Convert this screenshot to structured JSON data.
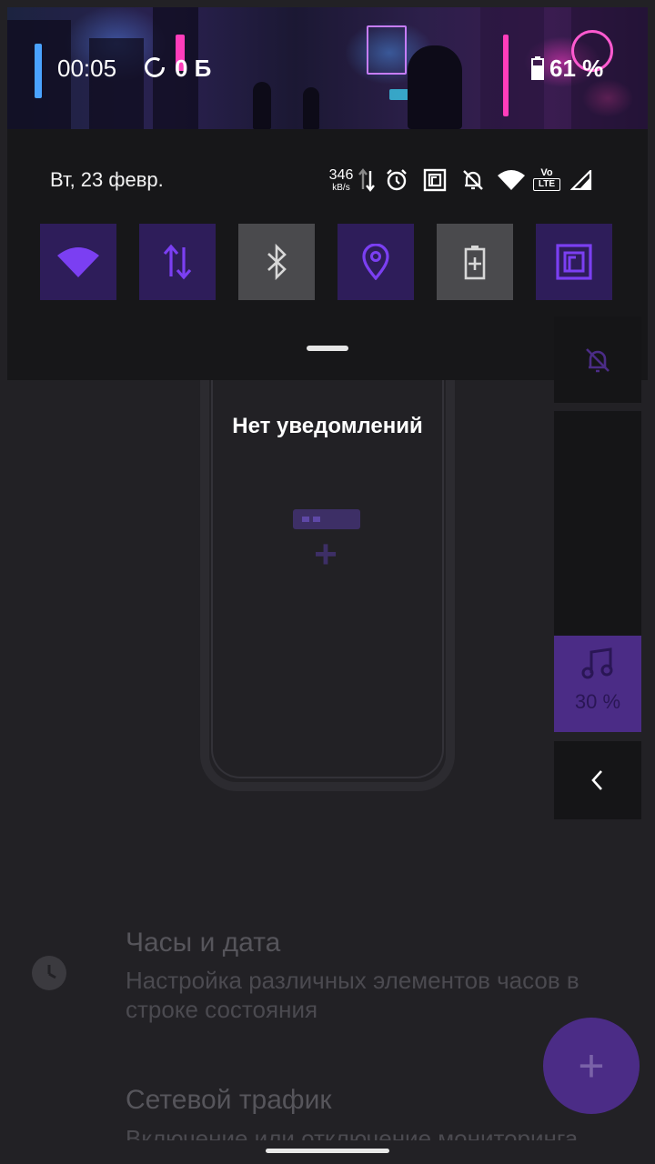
{
  "status_bar": {
    "time": "00:05",
    "data_usage": "0 Б",
    "battery_percent": "61 %"
  },
  "shade": {
    "date": "Вт, 23 февр.",
    "net_speed_value": "346",
    "net_speed_unit": "kB/s",
    "volte_label_top": "Vo",
    "volte_label_bottom": "LTE",
    "tiles": [
      {
        "name": "wifi",
        "active": true
      },
      {
        "name": "mobile-data",
        "active": true
      },
      {
        "name": "bluetooth",
        "active": false
      },
      {
        "name": "location",
        "active": true
      },
      {
        "name": "battery-saver",
        "active": false
      },
      {
        "name": "nfc",
        "active": true
      }
    ]
  },
  "notifications": {
    "empty_text": "Нет уведомлений"
  },
  "volume_panel": {
    "level_text": "30 %",
    "level_fraction": 0.3
  },
  "background_app": {
    "items": [
      {
        "title": "Часы и дата",
        "subtitle_line1": "Настройка различных элементов часов в",
        "subtitle_line2": "строке состояния"
      },
      {
        "title": "Сетевой трафик",
        "subtitle_line1": "Включение или отключение мониторинга"
      }
    ],
    "fab_label": "+"
  },
  "colors": {
    "accent": "#7b3ff2",
    "tile_active_bg": "#2e1d5a",
    "tile_inactive_bg": "#4a4a4d"
  }
}
